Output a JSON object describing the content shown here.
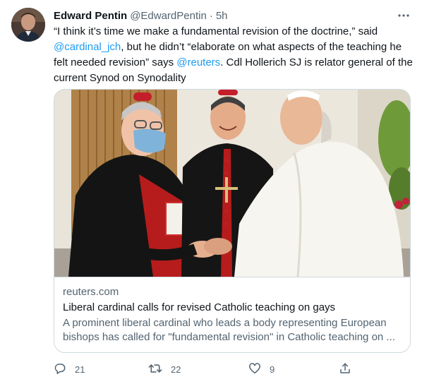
{
  "tweet": {
    "author_name": "Edward Pentin",
    "author_handle": "@EdwardPentin",
    "separator": "·",
    "time": "5h",
    "text_part1": "“I think it’s time we make a fundamental revision of the doctrine,” said ",
    "mention_1": "@cardinal_jch",
    "text_part2": ", but he didn’t “elaborate on what aspects of the teaching he felt needed revision” says ",
    "mention_2": "@reuters",
    "text_part3": ". Cdl Hollerich SJ is relator general of the current Synod on Synodality"
  },
  "card": {
    "domain": "reuters.com",
    "title": "Liberal cardinal calls for revised Catholic teaching on gays",
    "description": "A prominent liberal cardinal who leads a body representing European bishops has called for \"fundamental revision\" in Catholic teaching on ..."
  },
  "actions": {
    "replies": "21",
    "retweets": "22",
    "likes": "9"
  },
  "icons": {
    "more": "more-icon",
    "reply": "reply-icon",
    "retweet": "retweet-icon",
    "like": "heart-icon",
    "share": "share-icon"
  },
  "colors": {
    "link": "#1d9bf0",
    "secondary_text": "#536471",
    "border": "#cfd9de"
  }
}
